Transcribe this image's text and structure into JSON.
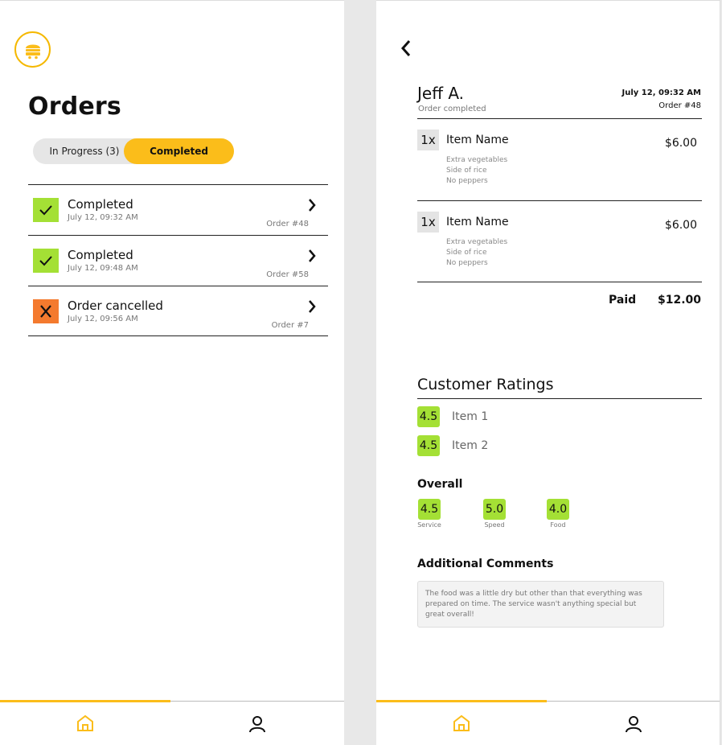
{
  "list_screen": {
    "title": "Orders",
    "tabs": {
      "in_progress": "In Progress (3)",
      "completed": "Completed"
    },
    "orders": [
      {
        "status": "Completed",
        "time": "July 12, 09:32 AM",
        "order_no": "Order #48",
        "type": "completed"
      },
      {
        "status": "Completed",
        "time": "July 12, 09:48 AM",
        "order_no": "Order #58",
        "type": "completed"
      },
      {
        "status": "Order cancelled",
        "time": "July 12, 09:56 AM",
        "order_no": "Order #7",
        "type": "cancelled"
      }
    ]
  },
  "detail_screen": {
    "customer": "Jeff A.",
    "order_state": "Order completed",
    "date": "July 12, 09:32 AM",
    "order_no": "Order #48",
    "items": [
      {
        "qty": "1x",
        "name": "Item Name",
        "price": "$6.00",
        "notes": [
          "Extra vegetables",
          "Side of rice",
          "No peppers"
        ]
      },
      {
        "qty": "1x",
        "name": "Item Name",
        "price": "$6.00",
        "notes": [
          "Extra vegetables",
          "Side of rice",
          "No peppers"
        ]
      }
    ],
    "paid_label": "Paid",
    "paid_amount": "$12.00",
    "ratings_title": "Customer Ratings",
    "item_ratings": [
      {
        "score": "4.5",
        "label": "Item 1"
      },
      {
        "score": "4.5",
        "label": "Item 2"
      }
    ],
    "overall_title": "Overall",
    "overall": [
      {
        "score": "4.5",
        "label": "Service"
      },
      {
        "score": "5.0",
        "label": "Speed"
      },
      {
        "score": "4.0",
        "label": "Food"
      }
    ],
    "comments_title": "Additional Comments",
    "comment": "The food was a little dry but other than that everything was prepared on time. The service wasn't anything special but great overall!"
  },
  "nav": {
    "active": "home",
    "items": [
      "home-icon",
      "user-icon"
    ]
  },
  "colors": {
    "accent": "#fbbd1a",
    "rating_green": "#a4e035",
    "cancel_orange": "#f47a2e"
  },
  "icons": {
    "logo": "burger-logo-icon",
    "check": "check-icon",
    "cancel": "x-icon",
    "chevron": "chevron-right-icon",
    "back": "chevron-left-icon"
  }
}
